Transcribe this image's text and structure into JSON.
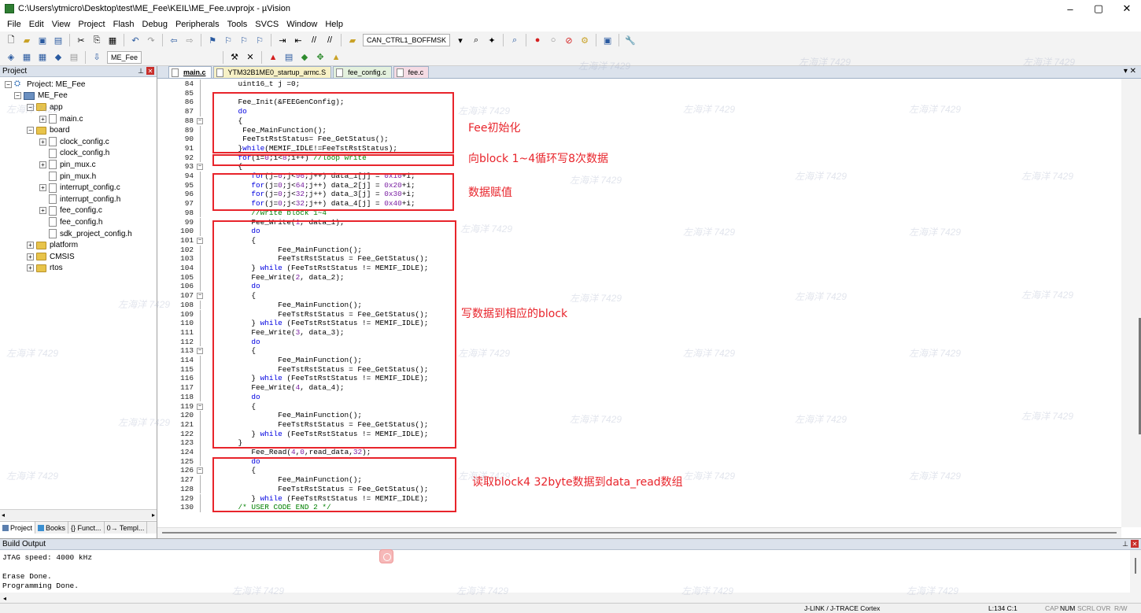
{
  "window": {
    "title": "C:\\Users\\ytmicro\\Desktop\\test\\ME_Fee\\KEIL\\ME_Fee.uvprojx - µVision",
    "minimize": "–",
    "maximize": "▢",
    "close": "✕"
  },
  "menu": [
    "File",
    "Edit",
    "View",
    "Project",
    "Flash",
    "Debug",
    "Peripherals",
    "Tools",
    "SVCS",
    "Window",
    "Help"
  ],
  "toolbar": {
    "combo1": "CAN_CTRL1_BOFFMSK",
    "target_combo": "ME_Fee"
  },
  "project_pane": {
    "title": "Project",
    "tree": [
      {
        "label": "Project: ME_Fee",
        "level": 0,
        "kind": "project",
        "exp": "-"
      },
      {
        "label": "ME_Fee",
        "level": 1,
        "kind": "target",
        "exp": "-"
      },
      {
        "label": "app",
        "level": 2,
        "kind": "folder",
        "exp": "-"
      },
      {
        "label": "main.c",
        "level": 3,
        "kind": "file",
        "exp": "+"
      },
      {
        "label": "board",
        "level": 2,
        "kind": "folder",
        "exp": "-"
      },
      {
        "label": "clock_config.c",
        "level": 3,
        "kind": "file",
        "exp": "+"
      },
      {
        "label": "clock_config.h",
        "level": 3,
        "kind": "file",
        "exp": ""
      },
      {
        "label": "pin_mux.c",
        "level": 3,
        "kind": "file",
        "exp": "+"
      },
      {
        "label": "pin_mux.h",
        "level": 3,
        "kind": "file",
        "exp": ""
      },
      {
        "label": "interrupt_config.c",
        "level": 3,
        "kind": "file",
        "exp": "+"
      },
      {
        "label": "interrupt_config.h",
        "level": 3,
        "kind": "file",
        "exp": ""
      },
      {
        "label": "fee_config.c",
        "level": 3,
        "kind": "file",
        "exp": "+"
      },
      {
        "label": "fee_config.h",
        "level": 3,
        "kind": "file",
        "exp": ""
      },
      {
        "label": "sdk_project_config.h",
        "level": 3,
        "kind": "file",
        "exp": ""
      },
      {
        "label": "platform",
        "level": 2,
        "kind": "folder",
        "exp": "+"
      },
      {
        "label": "CMSIS",
        "level": 2,
        "kind": "folder",
        "exp": "+"
      },
      {
        "label": "rtos",
        "level": 2,
        "kind": "folder",
        "exp": "+"
      }
    ],
    "tabs": [
      "Project",
      "Books",
      "{} Funct...",
      "0→ Templ..."
    ]
  },
  "editor": {
    "tabs": [
      {
        "label": "main.c",
        "style": "active"
      },
      {
        "label": "YTM32B1ME0_startup_armc.S",
        "style": "yellow"
      },
      {
        "label": "fee_config.c",
        "style": "green"
      },
      {
        "label": "fee.c",
        "style": "pink"
      }
    ],
    "lines": [
      {
        "n": "84",
        "fold": "",
        "html": "    uint16_t j =0;"
      },
      {
        "n": "85",
        "fold": "",
        "html": ""
      },
      {
        "n": "86",
        "fold": "",
        "html": "    Fee_Init(&FEEGenConfig);"
      },
      {
        "n": "87",
        "fold": "",
        "html": "    <span class=\"kw\">do</span>"
      },
      {
        "n": "88",
        "fold": "-",
        "html": "    {"
      },
      {
        "n": "89",
        "fold": "",
        "html": "     Fee_MainFunction();"
      },
      {
        "n": "90",
        "fold": "",
        "html": "     FeeTstRstStatus= Fee_GetStatus();"
      },
      {
        "n": "91",
        "fold": "",
        "html": "    }<span class=\"kw\">while</span>(MEMIF_IDLE!=FeeTstRstStatus);"
      },
      {
        "n": "92",
        "fold": "",
        "html": "    <span class=\"kw\">for</span>(i=<span class=\"num\">0</span>;i<<span class=\"num\">8</span>;i++) <span class=\"cmt\">//loop write</span>"
      },
      {
        "n": "93",
        "fold": "-",
        "html": "    {"
      },
      {
        "n": "94",
        "fold": "",
        "html": "       <span class=\"kw\">for</span>(j=<span class=\"num\">0</span>;j<<span class=\"num\">96</span>;j++) data_1[j] = <span class=\"num\">0x10</span>+i;"
      },
      {
        "n": "95",
        "fold": "",
        "html": "       <span class=\"kw\">for</span>(j=<span class=\"num\">0</span>;j<<span class=\"num\">64</span>;j++) data_2[j] = <span class=\"num\">0x20</span>+i;"
      },
      {
        "n": "96",
        "fold": "",
        "html": "       <span class=\"kw\">for</span>(j=<span class=\"num\">0</span>;j<<span class=\"num\">32</span>;j++) data_3[j] = <span class=\"num\">0x30</span>+i;"
      },
      {
        "n": "97",
        "fold": "",
        "html": "       <span class=\"kw\">for</span>(j=<span class=\"num\">0</span>;j<<span class=\"num\">32</span>;j++) data_4[j] = <span class=\"num\">0x40</span>+i;"
      },
      {
        "n": "98",
        "fold": "",
        "html": "       <span class=\"cmt\">//write block 1~4</span>"
      },
      {
        "n": "99",
        "fold": "",
        "html": "       Fee_Write(<span class=\"num\">1</span>, data_1);"
      },
      {
        "n": "100",
        "fold": "",
        "html": "       <span class=\"kw\">do</span>"
      },
      {
        "n": "101",
        "fold": "-",
        "html": "       {"
      },
      {
        "n": "102",
        "fold": "",
        "html": "             Fee_MainFunction();"
      },
      {
        "n": "103",
        "fold": "",
        "html": "             FeeTstRstStatus = Fee_GetStatus();"
      },
      {
        "n": "104",
        "fold": "",
        "html": "       } <span class=\"kw\">while</span> (FeeTstRstStatus != MEMIF_IDLE);"
      },
      {
        "n": "105",
        "fold": "",
        "html": "       Fee_Write(<span class=\"num\">2</span>, data_2);"
      },
      {
        "n": "106",
        "fold": "",
        "html": "       <span class=\"kw\">do</span>"
      },
      {
        "n": "107",
        "fold": "-",
        "html": "       {"
      },
      {
        "n": "108",
        "fold": "",
        "html": "             Fee_MainFunction();"
      },
      {
        "n": "109",
        "fold": "",
        "html": "             FeeTstRstStatus = Fee_GetStatus();"
      },
      {
        "n": "110",
        "fold": "",
        "html": "       } <span class=\"kw\">while</span> (FeeTstRstStatus != MEMIF_IDLE);"
      },
      {
        "n": "111",
        "fold": "",
        "html": "       Fee_Write(<span class=\"num\">3</span>, data_3);"
      },
      {
        "n": "112",
        "fold": "",
        "html": "       <span class=\"kw\">do</span>"
      },
      {
        "n": "113",
        "fold": "-",
        "html": "       {"
      },
      {
        "n": "114",
        "fold": "",
        "html": "             Fee_MainFunction();"
      },
      {
        "n": "115",
        "fold": "",
        "html": "             FeeTstRstStatus = Fee_GetStatus();"
      },
      {
        "n": "116",
        "fold": "",
        "html": "       } <span class=\"kw\">while</span> (FeeTstRstStatus != MEMIF_IDLE);"
      },
      {
        "n": "117",
        "fold": "",
        "html": "       Fee_Write(<span class=\"num\">4</span>, data_4);"
      },
      {
        "n": "118",
        "fold": "",
        "html": "       <span class=\"kw\">do</span>"
      },
      {
        "n": "119",
        "fold": "-",
        "html": "       {"
      },
      {
        "n": "120",
        "fold": "",
        "html": "             Fee_MainFunction();"
      },
      {
        "n": "121",
        "fold": "",
        "html": "             FeeTstRstStatus = Fee_GetStatus();"
      },
      {
        "n": "122",
        "fold": "",
        "html": "       } <span class=\"kw\">while</span> (FeeTstRstStatus != MEMIF_IDLE);"
      },
      {
        "n": "123",
        "fold": "",
        "html": "    }"
      },
      {
        "n": "124",
        "fold": "",
        "html": "       Fee_Read(<span class=\"num\">4</span>,<span class=\"num\">0</span>,read_data,<span class=\"num\">32</span>);"
      },
      {
        "n": "125",
        "fold": "",
        "html": "       <span class=\"kw\">do</span>"
      },
      {
        "n": "126",
        "fold": "-",
        "html": "       {"
      },
      {
        "n": "127",
        "fold": "",
        "html": "             Fee_MainFunction();"
      },
      {
        "n": "128",
        "fold": "",
        "html": "             FeeTstRstStatus = Fee_GetStatus();"
      },
      {
        "n": "129",
        "fold": "",
        "html": "       } <span class=\"kw\">while</span> (FeeTstRstStatus != MEMIF_IDLE);"
      },
      {
        "n": "130",
        "fold": "",
        "html": "    <span class=\"cmt\">/* USER CODE END 2 */</span>"
      }
    ],
    "annotations": [
      "Fee初始化",
      "向block 1~4循环写8次数据",
      "数据赋值",
      "写数据到相应的block",
      "读取block4 32byte数据到data_read数组"
    ]
  },
  "build_output": {
    "title": "Build Output",
    "lines": [
      "JTAG speed: 4000 kHz",
      "",
      "Erase Done.",
      "Programming Done."
    ]
  },
  "status": {
    "debugger": "J-LINK / J-TRACE Cortex",
    "position": "L:134 C:1",
    "caps": "CAP",
    "num": "NUM",
    "scrl": "SCRL",
    "ovr": "OVR",
    "rw": "R/W"
  },
  "watermark": "左海洋 7429",
  "colors": {
    "annotation": "#e8242b",
    "keyword": "#0000e0",
    "comment": "#008000",
    "number": "#7a1fa2"
  }
}
